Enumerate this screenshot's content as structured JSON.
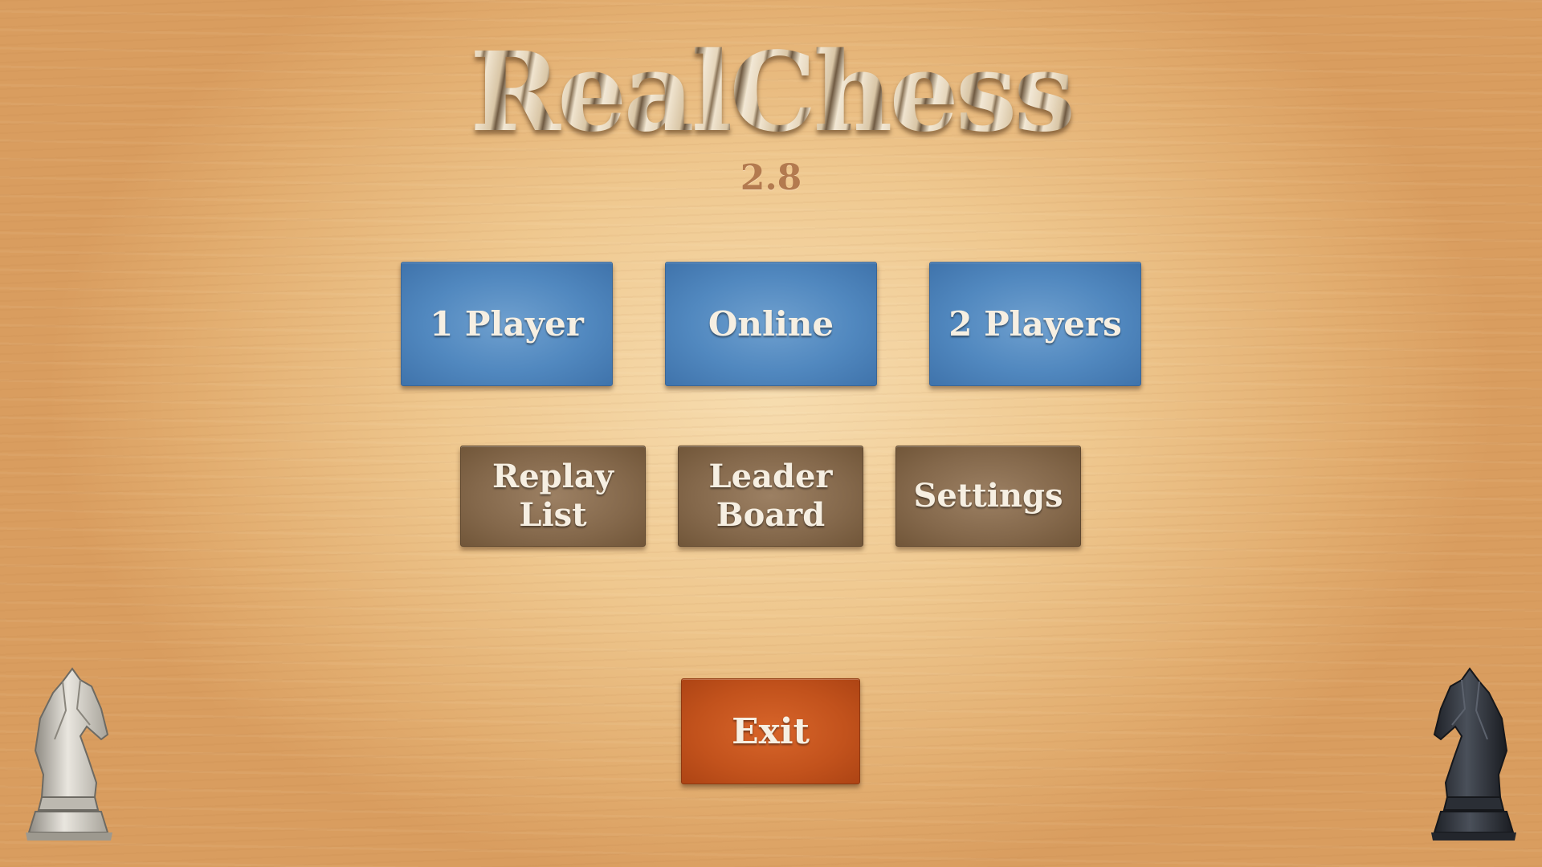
{
  "app": {
    "title": "RealChess",
    "version": "2.8"
  },
  "menu": {
    "primary": [
      {
        "label": "1 Player"
      },
      {
        "label": "Online"
      },
      {
        "label": "2 Players"
      }
    ],
    "secondary": [
      {
        "line1": "Replay",
        "line2": "List"
      },
      {
        "line1": "Leader",
        "line2": "Board"
      },
      {
        "line1": "Settings",
        "line2": ""
      }
    ],
    "exit_label": "Exit"
  },
  "decorations": {
    "left_icon": "white-knight-icon",
    "right_icon": "black-knight-icon"
  },
  "colors": {
    "primary_button": "#5188bf",
    "secondary_button": "#84684b",
    "exit_button": "#c2521c",
    "background": "#efc88f"
  }
}
